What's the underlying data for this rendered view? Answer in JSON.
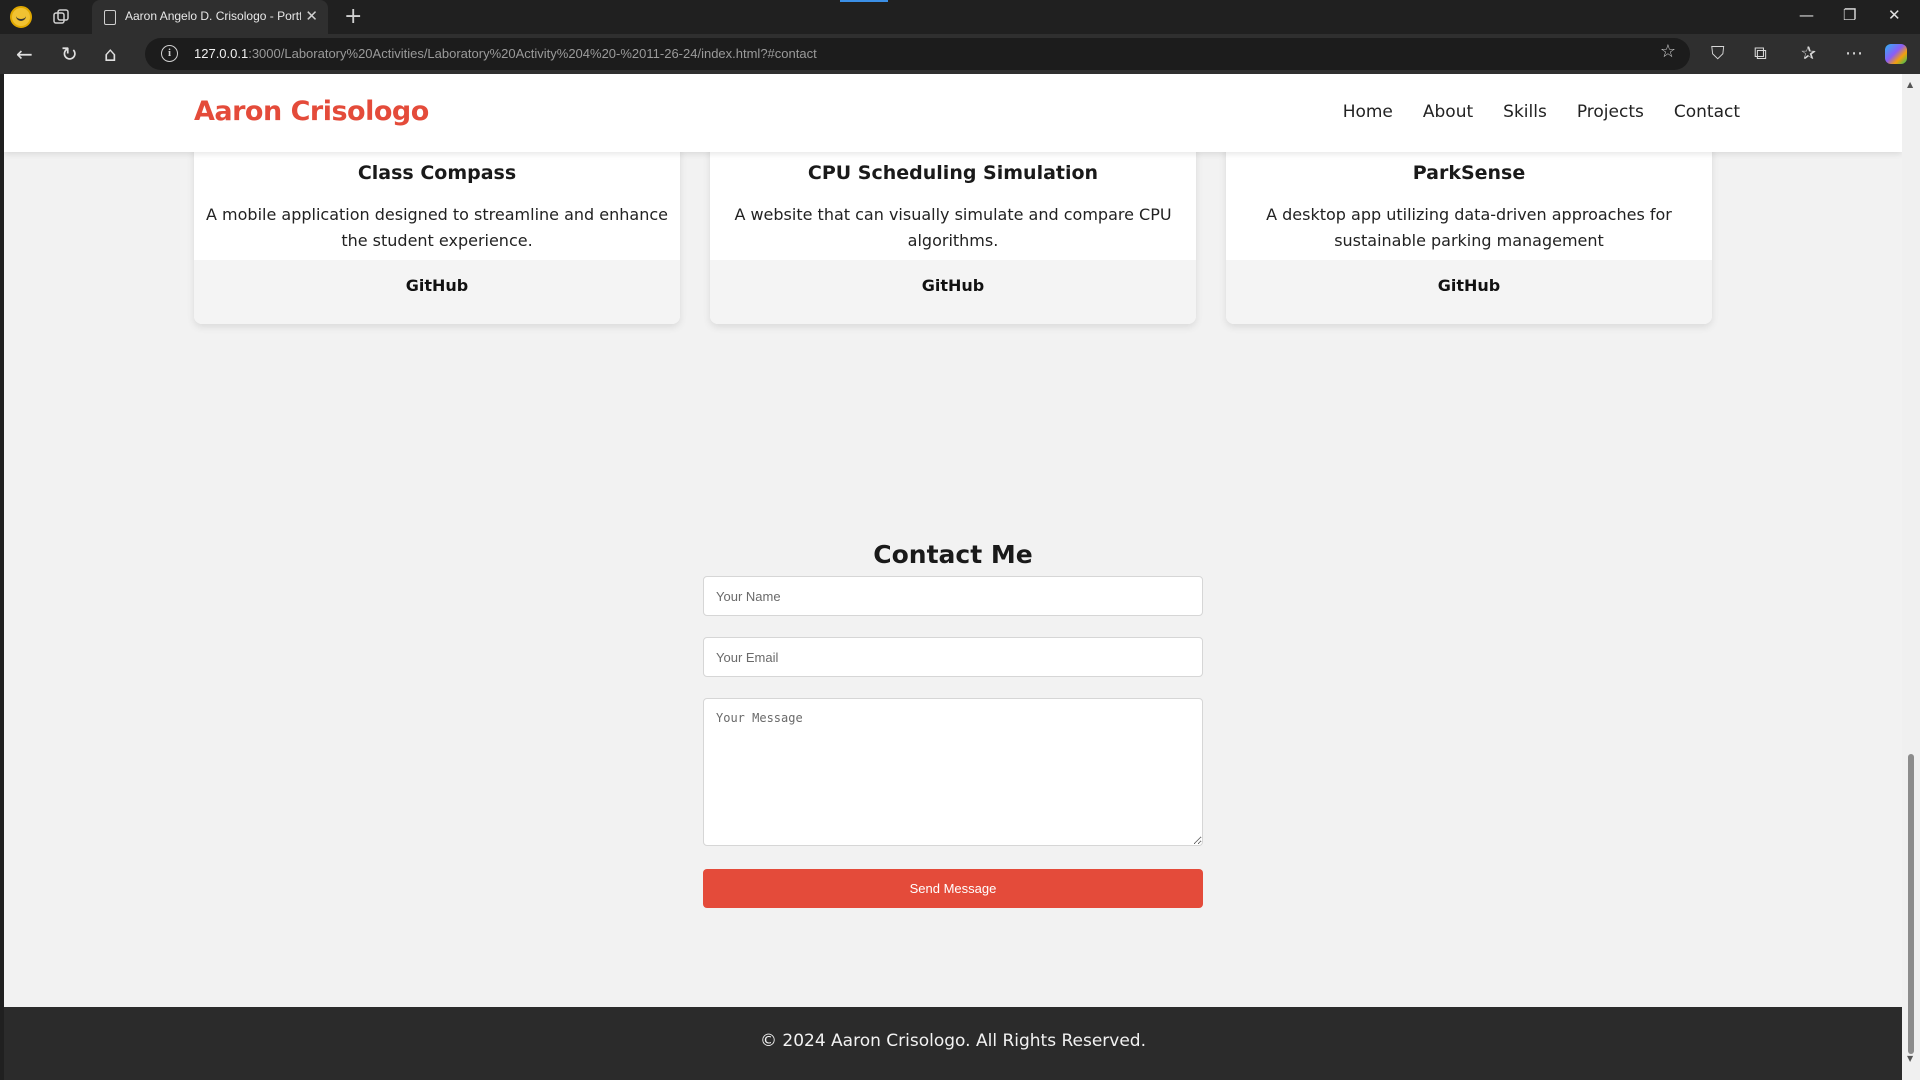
{
  "browser": {
    "tab_title": "Aaron Angelo D. Crisologo - Portfolio",
    "url_host": "127.0.0.1",
    "url_rest": ":3000/Laboratory%20Activities/Laboratory%20Activity%204%20-%2011-26-24/index.html?#contact",
    "icons": [
      "profile-icon",
      "workspaces-icon",
      "page-icon",
      "close-icon",
      "new-tab-icon",
      "back-icon",
      "reload-icon",
      "home-icon",
      "info-icon",
      "star-icon",
      "shield-icon",
      "extensions-icon",
      "favorites-icon",
      "more-icon",
      "copilot-icon"
    ]
  },
  "site": {
    "brand": "Aaron Crisologo",
    "brand_color": "#e44b3a",
    "nav": [
      "Home",
      "About",
      "Skills",
      "Projects",
      "Contact"
    ]
  },
  "projects": [
    {
      "title": "Class Compass",
      "desc": "A mobile application designed to streamline and enhance the student experience.",
      "link": "GitHub"
    },
    {
      "title": "CPU Scheduling Simulation",
      "desc": "A website that can visually simulate and compare CPU algorithms.",
      "link": "GitHub"
    },
    {
      "title": "ParkSense",
      "desc": "A desktop app utilizing data-driven approaches for sustainable parking management",
      "link": "GitHub"
    }
  ],
  "contact": {
    "title": "Contact Me",
    "name_placeholder": "Your Name",
    "email_placeholder": "Your Email",
    "message_placeholder": "Your Message",
    "button": "Send Message"
  },
  "footer": {
    "text": "© 2024 Aaron Crisologo. All Rights Reserved."
  }
}
